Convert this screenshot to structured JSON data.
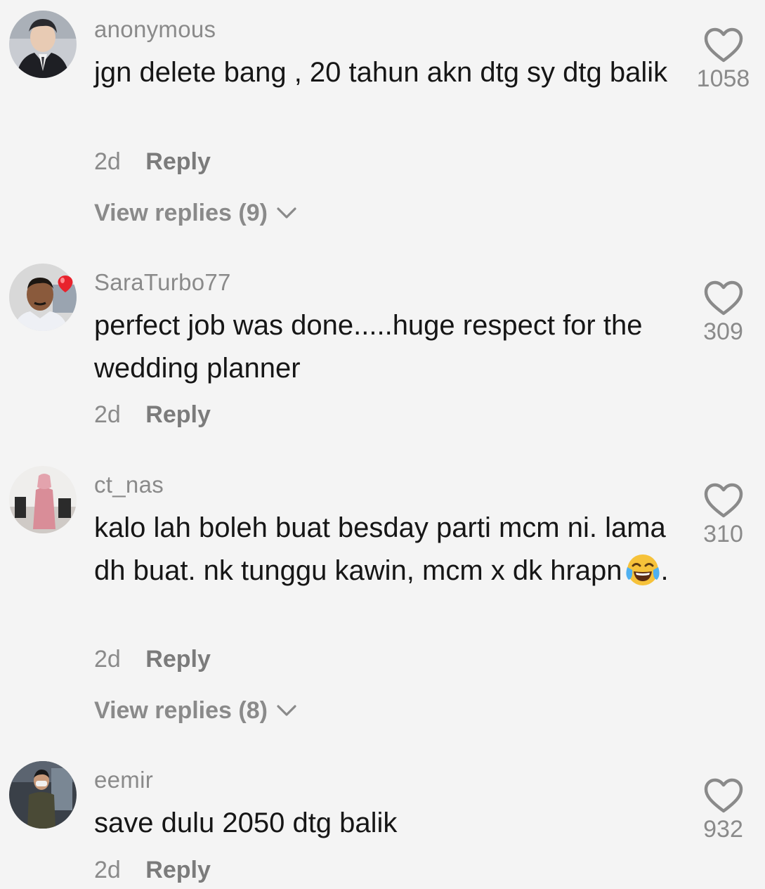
{
  "comments": [
    {
      "username": "anonymous",
      "text": "jgn delete bang , 20 tahun akn dtg sy dtg balik",
      "time": "2d",
      "reply": "Reply",
      "view_replies": "View replies (9)",
      "likes": "1058",
      "avatar_icon": "user-avatar-photo"
    },
    {
      "username": "SaraTurbo77",
      "text": "perfect job was done.....huge respect for the wedding planner",
      "time": "2d",
      "reply": "Reply",
      "likes": "309",
      "avatar_icon": "user-avatar-photo",
      "badge_icon": "red-balloon-icon"
    },
    {
      "username": "ct_nas",
      "text": "kalo lah boleh buat besday parti mcm ni. lama dh buat. nk tunggu kawin, mcm x dk hrapn",
      "text_suffix": ".",
      "emoji_icon": "tears-of-joy-emoji",
      "time": "2d",
      "reply": "Reply",
      "view_replies": "View replies (8)",
      "likes": "310",
      "avatar_icon": "user-avatar-photo"
    },
    {
      "username": "eemir",
      "text": "save dulu 2050 dtg balik",
      "time": "2d",
      "reply": "Reply",
      "likes": "932",
      "avatar_icon": "user-avatar-photo"
    }
  ],
  "colors": {
    "background": "#f4f4f4",
    "text": "#161616",
    "muted": "#8a8a8a"
  }
}
